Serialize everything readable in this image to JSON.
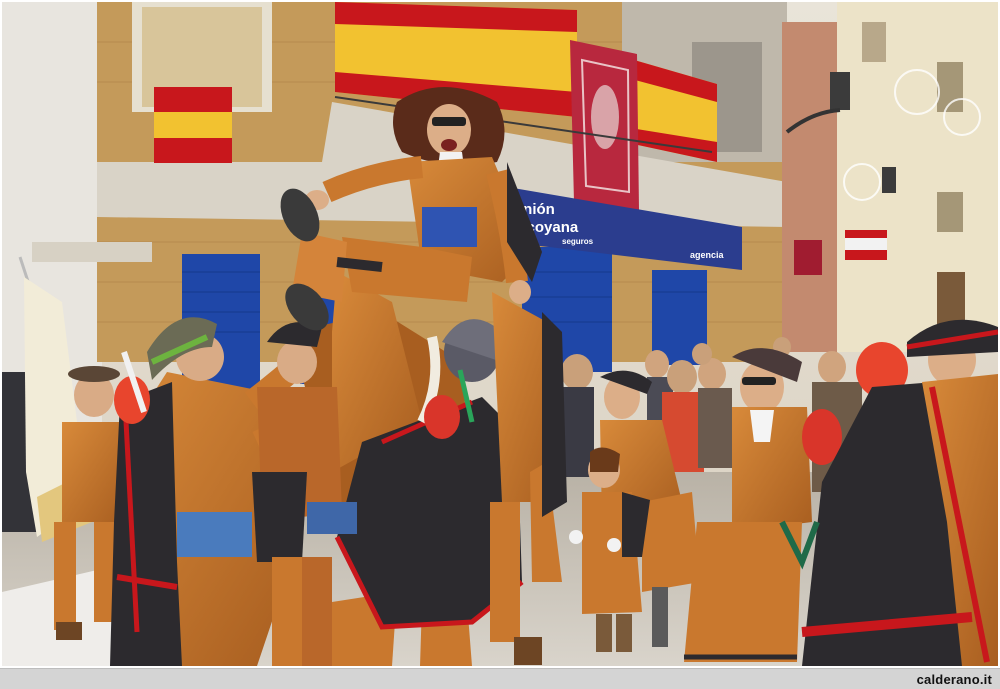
{
  "photo": {
    "description_alt": "Carnival parade: people in orange and black musketeer costumes toss a laughing woman into the air on a town street",
    "colors": {
      "costume_orange": "#c9782e",
      "cape_black": "#2c2a2e",
      "trim_red": "#c8171c",
      "shutter_blue": "#1f47a8",
      "flag_red": "#c8171c",
      "flag_yellow": "#f2c230",
      "building_brick": "#c49a5a"
    },
    "shop_sign": {
      "line1": "unión",
      "line2": "alcoyana",
      "line3": "seguros",
      "agency": "agencia"
    }
  },
  "footer": {
    "credit": "calderano.it"
  }
}
